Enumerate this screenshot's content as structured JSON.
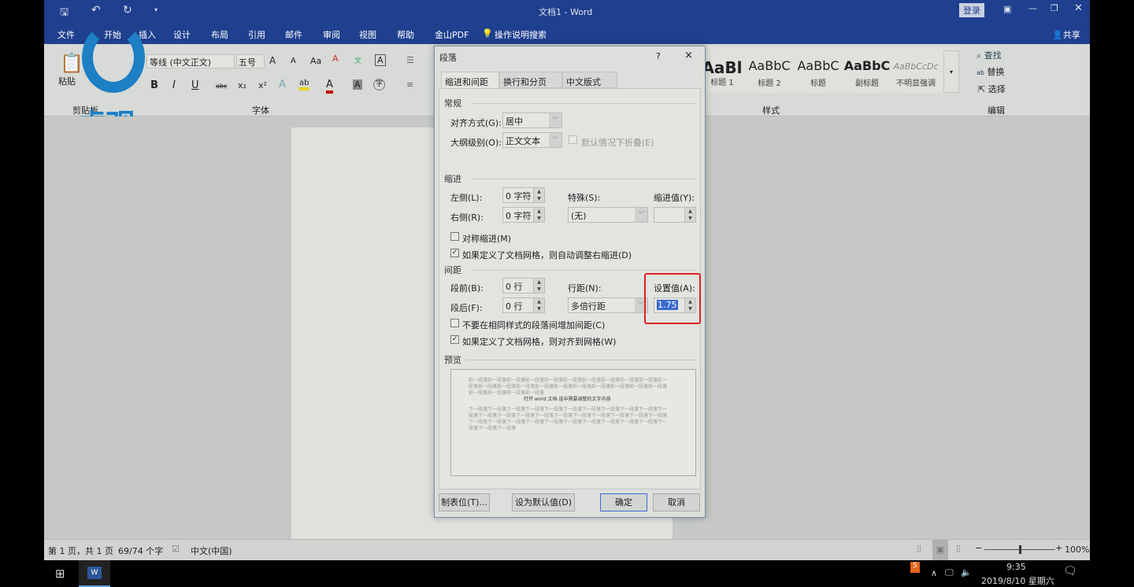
{
  "titlebar": {
    "title": "文档1  -  Word",
    "login": "登录"
  },
  "menu": [
    "文件",
    "开始",
    "插入",
    "设计",
    "布局",
    "引用",
    "邮件",
    "审阅",
    "视图",
    "帮助",
    "金山PDF"
  ],
  "tell_me": "操作说明搜索",
  "share": "共享",
  "ribbon": {
    "paste": "粘贴",
    "clipboard": "剪贴板",
    "font_name": "等线 (中文正文)",
    "font_size": "五号",
    "font_group": "字体",
    "styles_group": "样式",
    "edit_group": "编辑",
    "styles": [
      {
        "sample": "AaBl",
        "name": "标题 1"
      },
      {
        "sample": "AaBbC",
        "name": "标题 2"
      },
      {
        "sample": "AaBbC",
        "name": "标题"
      },
      {
        "sample": "AaBbC",
        "name": "副标题"
      },
      {
        "sample": "AaBbCcDc",
        "name": "不明显强调"
      }
    ],
    "find": "查找",
    "replace": "替换",
    "select": "选择"
  },
  "watermark": "虎观",
  "dialog": {
    "title": "段落",
    "help": "?",
    "close": "×",
    "tabs": [
      "缩进和间距(I)",
      "换行和分页(P)",
      "中文版式(H)"
    ],
    "general": "常规",
    "align_label": "对齐方式(G):",
    "align_value": "居中",
    "outline_label": "大纲级别(O):",
    "outline_value": "正文文本",
    "collapse": "默认情况下折叠(E)",
    "indent": "缩进",
    "left_label": "左侧(L):",
    "left_value": "0 字符",
    "right_label": "右侧(R):",
    "right_value": "0 字符",
    "special_label": "特殊(S):",
    "special_value": "(无)",
    "by_label": "缩进值(Y):",
    "by_value": "",
    "mirror": "对称缩进(M)",
    "auto_right": "如果定义了文档网格，则自动调整右缩进(D)",
    "spacing": "间距",
    "before_label": "段前(B):",
    "before_value": "0 行",
    "after_label": "段后(F):",
    "after_value": "0 行",
    "line_label": "行距(N):",
    "line_value": "多倍行距",
    "at_label": "设置值(A):",
    "at_value": "1.75",
    "no_space": "不要在相同样式的段落间增加间距(C)",
    "snap_grid": "如果定义了文档网格，则对齐到网格(W)",
    "preview": "预览",
    "preview_prev": [
      "前一段落前一段落前一段落前一段落前一段落前一段落前一段落前一段落前一段落前一段落前一",
      "段落前一段落前一段落前一段落前一段落前一段落前一段落前一段落前一段落前一段落前一段落",
      "前一段落前一段落前一段落前一段落"
    ],
    "preview_text": "打开 word 文档   选中需要调整的文字内容",
    "preview_next": [
      "下一段落下一段落下一段落下一段落下一段落下一段落下一段落下一段落下一段落下一段落下一",
      "段落下一段落下一段落下一段落下一段落下一段落下一段落下一段落下一段落下一段落下一段落",
      "下一段落下一段落下一段落下一段落下一段落下一段落下一段落下一段落下一段落下一段落下一",
      "段落下一段落下一段落"
    ],
    "tabs_btn": "制表位(T)...",
    "default_btn": "设为默认值(D)",
    "ok": "确定",
    "cancel": "取消"
  },
  "status": {
    "page": "第 1 页，共 1 页",
    "words": "69/74 个字",
    "lang": "中文(中国)",
    "zoom": "100%",
    "zoom_level": 100
  },
  "taskbar": {
    "time": "9:35",
    "date": "2019/8/10 星期六"
  },
  "colors": {
    "accent": "#1f3f8f",
    "highlight_box": "#e02020"
  }
}
